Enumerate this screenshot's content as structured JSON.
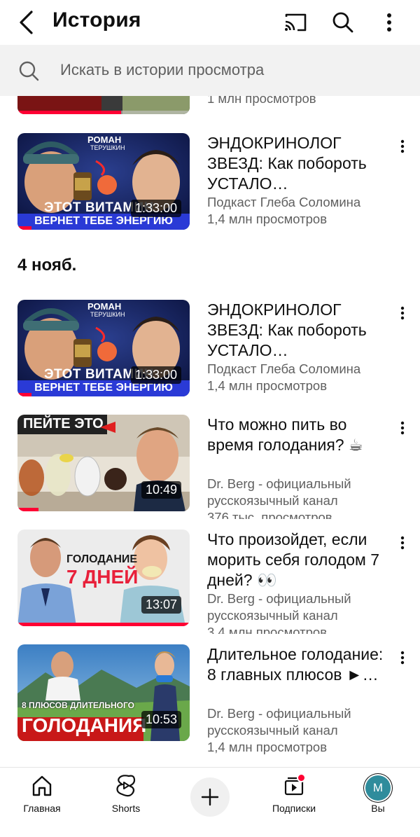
{
  "header": {
    "title": "История",
    "icons": [
      "back-arrow-icon",
      "cast-icon",
      "search-icon",
      "more-vert-icon"
    ]
  },
  "search": {
    "placeholder": "Искать в истории просмотра"
  },
  "partial_item": {
    "views": "1 млн просмотров"
  },
  "sections": [
    {
      "date": "",
      "videos": [
        {
          "title": "ЭНДОКРИНОЛОГ ЗВЕЗД: Как побороть УСТАЛО…",
          "channel": "Подкаст Глеба Соломина",
          "views": "1,4 млн просмотров",
          "duration": "1:33:00",
          "thumb_text_top": "РОМАН",
          "thumb_text_top2": "ТЕРУШКИН",
          "thumb_text_main": "ЭТОТ ВИТАМИН",
          "thumb_text_banner": "ВЕРНЕТ ТЕБЕ ЭНЕРГИЮ",
          "watched": 0.08
        }
      ]
    },
    {
      "date": "4 нояб.",
      "videos": [
        {
          "title": "ЭНДОКРИНОЛОГ ЗВЕЗД: Как побороть УСТАЛО…",
          "channel": "Подкаст Глеба Соломина",
          "views": "1,4 млн просмотров",
          "duration": "1:33:00",
          "thumb_text_top": "РОМАН",
          "thumb_text_top2": "ТЕРУШКИН",
          "thumb_text_main": "ЭТОТ ВИТАМИН",
          "thumb_text_banner": "ВЕРНЕТ ТЕБЕ ЭНЕРГИЮ",
          "watched": 0.08
        },
        {
          "title": "Что можно пить во время голодания? ☕",
          "channel": "Dr. Berg - официальный",
          "channel2": "русскоязычный канал",
          "views": "376 тыс. просмотров",
          "duration": "10:49",
          "thumb_text_main": "ПЕЙТЕ ЭТО",
          "watched": 0.12
        },
        {
          "title": "Что произойдет, если морить себя голодом 7 дней? 👀",
          "channel": "Dr. Berg - официальный",
          "channel2": "русскоязычный канал",
          "views": "3,4 млн просмотров",
          "duration": "13:07",
          "thumb_text_top": "ГОЛОДАНИЕ",
          "thumb_text_main": "7 ДНЕЙ",
          "watched": 1.0
        },
        {
          "title": "Длительное голодание: 8 главных плюсов ►…",
          "channel": "Dr. Berg - официальный",
          "channel2": "русскоязычный канал",
          "views": "1,4 млн просмотров",
          "duration": "10:53",
          "thumb_text_top": "8 ПЛЮСОВ ДЛИТЕЛЬНОГО",
          "thumb_text_main": "ГОЛОДАНИЯ",
          "watched": 0.0
        }
      ]
    }
  ],
  "bottom_nav": [
    {
      "label": "Главная",
      "icon": "home-icon"
    },
    {
      "label": "Shorts",
      "icon": "shorts-icon"
    },
    {
      "label": "",
      "icon": "create-plus-icon"
    },
    {
      "label": "Подписки",
      "icon": "subscriptions-icon"
    },
    {
      "label": "Вы",
      "icon": "avatar",
      "avatar_letter": "M"
    }
  ],
  "colors": {
    "accent": "#ff0033",
    "search_bg": "#f2f2f2",
    "secondary_text": "#606060",
    "avatar_bg": "#2f8c9c"
  }
}
